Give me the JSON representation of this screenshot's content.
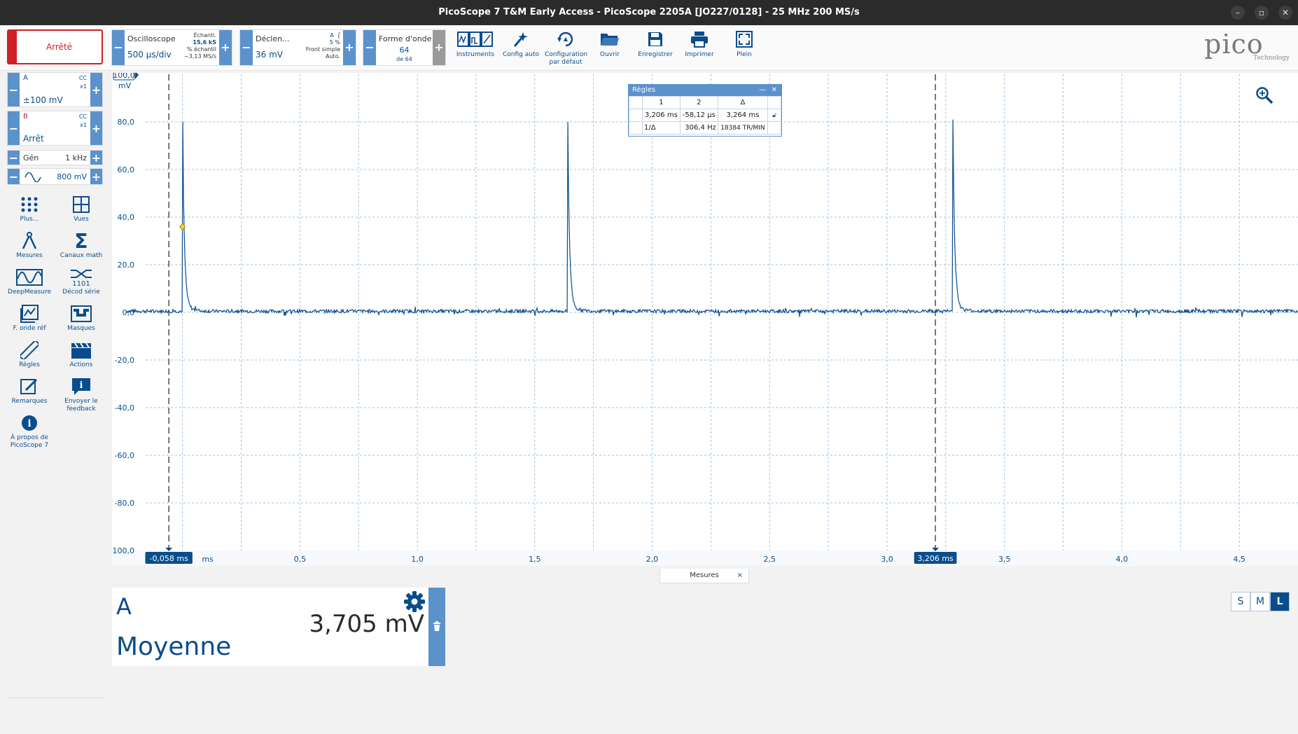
{
  "window": {
    "title": "PicoScope 7 T&M Early Access  - PicoScope 2205A [JO227/0128] - 25 MHz 200 MS/s",
    "minimize_label": "–",
    "maximize_label": "▫",
    "close_label": "✕"
  },
  "toolbar": {
    "run_state": "Arrêté",
    "scope": {
      "label": "Oscilloscope",
      "timebase": "500 µs/div",
      "samples_label": "Échanti.",
      "samples_value": "15,6 kS",
      "rate_label": "% échantil",
      "rate_value": "~3,13 MS/s"
    },
    "trigger": {
      "label": "Déclen...",
      "level": "36 mV",
      "source": "A",
      "pretrigger": "5 %",
      "type": "Front simple",
      "mode": "Auto."
    },
    "waveform": {
      "label": "Forme d'onde",
      "current": "64",
      "total": "de 64"
    },
    "tools": [
      {
        "label": "Instruments"
      },
      {
        "label": "Config auto"
      },
      {
        "label": "Configuration par défaut"
      },
      {
        "label": "Ouvrir"
      },
      {
        "label": "Enregistrer"
      },
      {
        "label": "Imprimer"
      },
      {
        "label": "Plein"
      }
    ],
    "logo": {
      "brand": "pico",
      "sub": "Technology"
    }
  },
  "channels": [
    {
      "name": "A",
      "coupling": "CC",
      "probe": "x1",
      "range": "±100 mV",
      "color": "#0a4d8c"
    },
    {
      "name": "B",
      "coupling": "CC",
      "probe": "x1",
      "range": "Arrêt",
      "color": "#d01f26"
    }
  ],
  "siggen": {
    "label": "Gén",
    "freq": "1 kHz",
    "amplitude": "800 mV"
  },
  "left_tools": [
    {
      "label": "Plus...",
      "icon": "dots-grid-icon"
    },
    {
      "label": "Vues",
      "icon": "views-grid-icon"
    },
    {
      "label": "Mesures",
      "icon": "compass-icon"
    },
    {
      "label": "Canaux math",
      "icon": "sigma-icon"
    },
    {
      "label": "DeepMeasure",
      "icon": "deepmeasure-icon"
    },
    {
      "label": "Décod série",
      "icon": "serial-decode-icon"
    },
    {
      "label": "F. onde réf",
      "icon": "ref-waveform-icon"
    },
    {
      "label": "Masques",
      "icon": "mask-icon"
    },
    {
      "label": "Règles",
      "icon": "ruler-icon"
    },
    {
      "label": "Actions",
      "icon": "clapper-icon"
    },
    {
      "label": "Remarques",
      "icon": "notes-icon"
    },
    {
      "label": "Envoyer le feedback",
      "icon": "feedback-icon"
    },
    {
      "label": "À propos de PicoScope 7",
      "icon": "info-icon"
    }
  ],
  "chart_data": {
    "type": "line",
    "y_unit": "mV",
    "y_ticks": [
      "100,0",
      "80,0",
      "60,0",
      "40,0",
      "20,0",
      "0,0",
      "-20,0",
      "-40,0",
      "-60,0",
      "-80,0",
      "-100,0"
    ],
    "x_ticks": [
      "0,5",
      "1,0",
      "1,5",
      "2,0",
      "2,5",
      "3,0",
      "3,5",
      "4,0",
      "4,5"
    ],
    "x_unit": "ms",
    "ylim": [
      -100,
      100
    ],
    "xlim": [
      -0.3,
      4.75
    ],
    "grid": true,
    "series": [
      {
        "color": "#0a4d8c",
        "baseline": 0.5,
        "pulses": [
          {
            "t": 0.0,
            "peak": 80
          },
          {
            "t": 1.64,
            "peak": 80
          },
          {
            "t": 3.28,
            "peak": 81
          }
        ]
      }
    ],
    "trigger_marker": {
      "t": 0.0,
      "level": 36
    },
    "rulers": [
      {
        "t": -0.058,
        "label": "-0,058 ms"
      },
      {
        "t": 3.206,
        "label": "3,206 ms"
      }
    ]
  },
  "rulers_panel": {
    "title": "Règles",
    "header": [
      "1",
      "2",
      "Δ"
    ],
    "row1": [
      "3,206 ms",
      "-58,12 µs",
      "3,264 ms"
    ],
    "row2": [
      "1/Δ",
      "306,4 Hz",
      "18384 TR/MIN"
    ]
  },
  "measurements": {
    "tab_label": "Mesures",
    "channel": "A",
    "name": "Moyenne",
    "value": "3,705 mV"
  },
  "view_size": {
    "options": [
      "S",
      "M",
      "L"
    ],
    "selected": "L"
  }
}
